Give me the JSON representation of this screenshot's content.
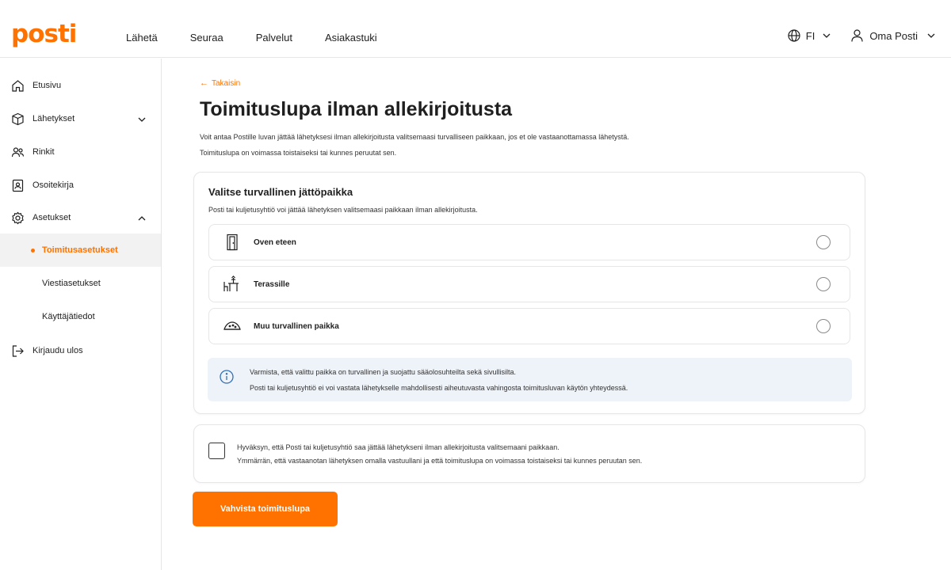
{
  "brand": {
    "logo_text": "posti",
    "accent": "#ff7200"
  },
  "nav": [
    "Lähetä",
    "Seuraa",
    "Palvelut",
    "Asiakastuki"
  ],
  "header": {
    "language": "FI",
    "account": "Oma Posti"
  },
  "sidebar": {
    "items": [
      {
        "label": "Etusivu",
        "icon": "home-icon"
      },
      {
        "label": "Lähetykset",
        "icon": "package-icon"
      },
      {
        "label": "Rinkit",
        "icon": "people-icon"
      },
      {
        "label": "Osoitekirja",
        "icon": "contact-book-icon"
      },
      {
        "label": "Asetukset",
        "icon": "gear-icon"
      },
      {
        "label": "Toimitusasetukset"
      },
      {
        "label": "Viestiasetukset"
      },
      {
        "label": "Käyttäjätiedot"
      },
      {
        "label": "Kirjaudu ulos",
        "icon": "logout-icon"
      }
    ]
  },
  "main": {
    "back": "Takaisin",
    "title": "Toimituslupa ilman allekirjoitusta",
    "desc1": "Voit antaa Postille luvan jättää lähetyksesi ilman allekirjoitusta valitsemaasi turvalliseen paikkaan, jos et ole vastaanottamassa lähetystä.",
    "desc2": "Toimituslupa on voimassa toistaiseksi tai kunnes peruutat sen."
  },
  "place_card": {
    "title": "Valitse turvallinen jättöpaikka",
    "subtitle": "Posti tai kuljetusyhtiö voi jättää lähetyksen valitsemaasi paikkaan ilman allekirjoitusta.",
    "options": [
      {
        "label": "Oven eteen",
        "icon": "door-icon",
        "selected": false
      },
      {
        "label": "Terassille",
        "icon": "terrace-icon",
        "selected": false
      },
      {
        "label": "Muu turvallinen paikka",
        "icon": "other-place-icon",
        "selected": false
      }
    ],
    "info_line1": "Varmista, että valittu paikka on turvallinen ja suojattu sääolosuhteilta sekä sivullisilta.",
    "info_line2": "Posti tai kuljetusyhtiö ei voi vastata lähetykselle mahdollisesti aiheutuvasta vahingosta toimitusluvan käytön yhteydessä."
  },
  "consent": {
    "checked": false,
    "line1": "Hyväksyn, että Posti tai kuljetusyhtiö saa jättää lähetykseni ilman allekirjoitusta valitsemaani paikkaan.",
    "line2": "Ymmärrän, että vastaanotan lähetyksen omalla vastuullani ja että toimituslupa on voimassa toistaiseksi tai kunnes peruutan sen."
  },
  "confirm_button": "Vahvista toimituslupa"
}
